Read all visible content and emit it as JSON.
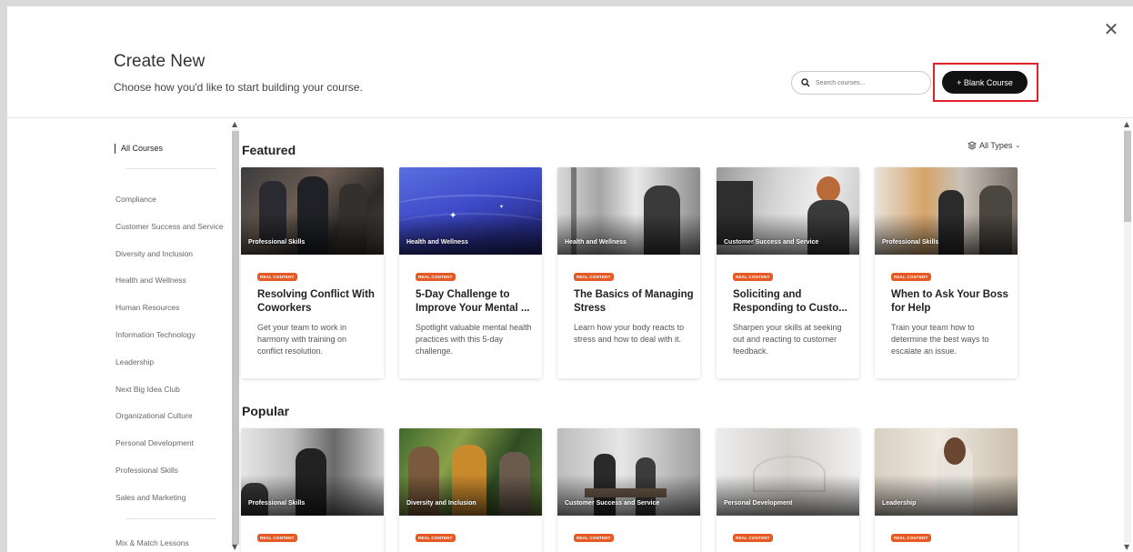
{
  "header": {
    "title": "Create New",
    "subtitle": "Choose how you'd like to start building your course.",
    "search_placeholder": "Search courses...",
    "blank_course_label": "+ Blank Course",
    "close_glyph": "✕"
  },
  "sidebar": {
    "all_courses": "All Courses",
    "items": [
      "Compliance",
      "Customer Success and Service",
      "Diversity and Inclusion",
      "Health and Wellness",
      "Human Resources",
      "Information Technology",
      "Leadership",
      "Next Big Idea Club",
      "Organizational Culture",
      "Personal Development",
      "Professional Skills",
      "Sales and Marketing"
    ],
    "mix_match": "Mix & Match Lessons"
  },
  "filter": {
    "all_types_label": "All Types"
  },
  "featured": {
    "title": "Featured",
    "cards": [
      {
        "category": "Professional Skills",
        "badge": "REAL CONTENT",
        "title": "Resolving Conflict With Coworkers",
        "description": "Get your team to work in harmony with training on conflict resolution."
      },
      {
        "category": "Health and Wellness",
        "badge": "REAL CONTENT",
        "title": "5-Day Challenge to Improve Your Mental ...",
        "description": "Spotlight valuable mental health practices with this 5-day challenge."
      },
      {
        "category": "Health and Wellness",
        "badge": "REAL CONTENT",
        "title": "The Basics of Managing Stress",
        "description": "Learn how your body reacts to stress and how to deal with it."
      },
      {
        "category": "Customer Success and Service",
        "badge": "REAL CONTENT",
        "title": "Soliciting and Responding to Custo...",
        "description": "Sharpen your skills at seeking out and reacting to customer feedback."
      },
      {
        "category": "Professional Skills",
        "badge": "REAL CONTENT",
        "title": "When to Ask Your Boss for Help",
        "description": "Train your team how to determine the best ways to escalate an issue."
      }
    ]
  },
  "popular": {
    "title": "Popular",
    "cards": [
      {
        "category": "Professional Skills",
        "badge": "REAL CONTENT"
      },
      {
        "category": "Diversity and Inclusion",
        "badge": "REAL CONTENT"
      },
      {
        "category": "Customer Success and Service",
        "badge": "REAL CONTENT"
      },
      {
        "category": "Personal Development",
        "badge": "REAL CONTENT"
      },
      {
        "category": "Leadership",
        "badge": "REAL CONTENT"
      }
    ]
  },
  "colors": {
    "badge": "#e55a24",
    "primary_button": "#111111",
    "highlight_border": "#e0202a"
  }
}
